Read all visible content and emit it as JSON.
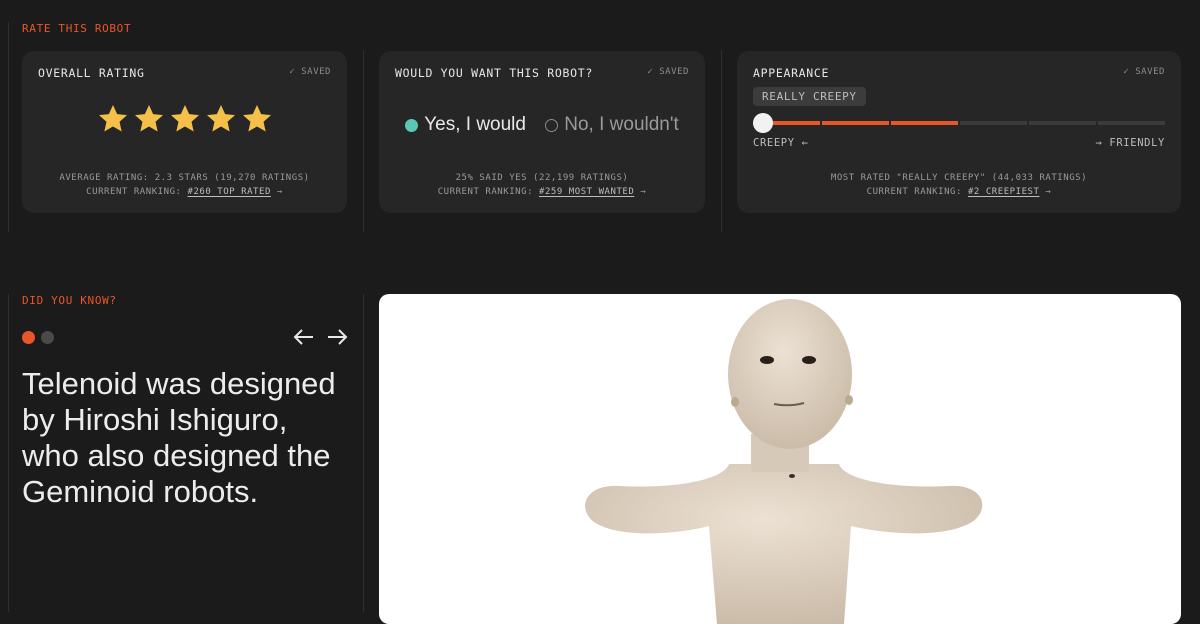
{
  "colors": {
    "accent": "#e8562a",
    "star": "#f5c04a",
    "selected_radio": "#5cc8b4"
  },
  "rate_section": {
    "label": "RATE THIS ROBOT"
  },
  "overall_rating": {
    "title": "OVERALL RATING",
    "saved": "✓ SAVED",
    "stars_selected": 5,
    "stars_total": 5,
    "stats": "AVERAGE RATING: 2.3 STARS (19,270 RATINGS)",
    "ranking_prefix": "CURRENT RANKING:",
    "ranking_link": "#260 TOP RATED"
  },
  "want_robot": {
    "title": "WOULD YOU WANT THIS ROBOT?",
    "saved": "✓ SAVED",
    "options": [
      {
        "label": "Yes, I would",
        "selected": true
      },
      {
        "label": "No, I wouldn't",
        "selected": false
      }
    ],
    "stats": "25% SAID YES (22,199 RATINGS)",
    "ranking_prefix": "CURRENT RANKING:",
    "ranking_link": "#259 MOST WANTED"
  },
  "appearance": {
    "title": "APPEARANCE",
    "saved": "✓ SAVED",
    "current_value": "REALLY CREEPY",
    "selected_step": 0,
    "filled_segments": 3,
    "total_segments": 6,
    "left_label": "CREEPY ←",
    "right_label": "→ FRIENDLY",
    "stats": "MOST RATED \"REALLY CREEPY\" (44,033 RATINGS)",
    "ranking_prefix": "CURRENT RANKING:",
    "ranking_link": "#2 CREEPIEST"
  },
  "did_you_know": {
    "label": "DID YOU KNOW?",
    "active_slide": 1,
    "total_slides": 2,
    "fact": "Telenoid was designed by Hiroshi Ishiguro, who also designed the Geminoid robots."
  }
}
